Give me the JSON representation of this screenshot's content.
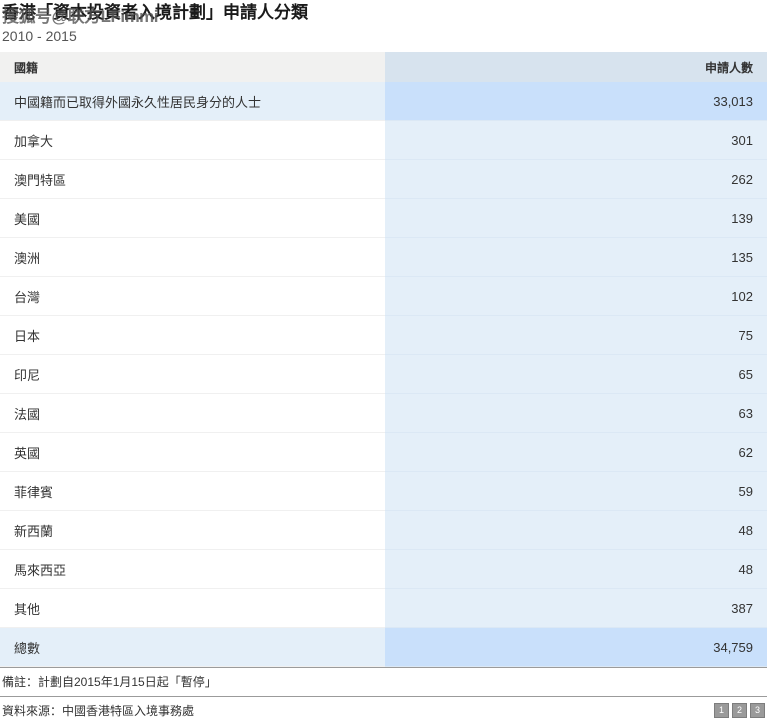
{
  "header": {
    "title": "香港「資本投資者入境計劃」申請人分類",
    "subtitle": "2010 - 2015",
    "watermark": "搜狐号@联方LFimmi"
  },
  "table": {
    "columns": {
      "name": "國籍",
      "value": "申請人數"
    },
    "rows": [
      {
        "name": "中國籍而已取得外國永久性居民身分的人士",
        "value": "33,013",
        "style": "highlight"
      },
      {
        "name": "加拿大",
        "value": "301",
        "style": "normal"
      },
      {
        "name": "澳門特區",
        "value": "262",
        "style": "normal"
      },
      {
        "name": "美國",
        "value": "139",
        "style": "normal"
      },
      {
        "name": "澳洲",
        "value": "135",
        "style": "normal"
      },
      {
        "name": "台灣",
        "value": "102",
        "style": "normal"
      },
      {
        "name": "日本",
        "value": "75",
        "style": "normal"
      },
      {
        "name": "印尼",
        "value": "65",
        "style": "normal"
      },
      {
        "name": "法國",
        "value": "63",
        "style": "normal"
      },
      {
        "name": "英國",
        "value": "62",
        "style": "normal"
      },
      {
        "name": "菲律賓",
        "value": "59",
        "style": "normal"
      },
      {
        "name": "新西蘭",
        "value": "48",
        "style": "normal"
      },
      {
        "name": "馬來西亞",
        "value": "48",
        "style": "normal"
      },
      {
        "name": "其他",
        "value": "387",
        "style": "normal"
      },
      {
        "name": "總數",
        "value": "34,759",
        "style": "total"
      }
    ]
  },
  "footnotes": [
    {
      "text": "備註：計劃自2015年1月15日起「暫停」"
    },
    {
      "text": "資料來源：中國香港特區入境事務處"
    }
  ],
  "badges": [
    "1",
    "2",
    "3"
  ],
  "colors": {
    "header_name_bg": "#f1f1f0",
    "header_value_bg": "#d7e3ee",
    "value_column_bg": "#e4eff9",
    "highlight_value_bg": "#c9e0fb"
  },
  "chart_data": {
    "type": "table",
    "title": "香港「資本投資者入境計劃」申請人分類",
    "subtitle": "2010 - 2015",
    "categories": [
      "中國籍而已取得外國永久性居民身分的人士",
      "加拿大",
      "澳門特區",
      "美國",
      "澳洲",
      "台灣",
      "日本",
      "印尼",
      "法國",
      "英國",
      "菲律賓",
      "新西蘭",
      "馬來西亞",
      "其他"
    ],
    "values": [
      33013,
      301,
      262,
      139,
      135,
      102,
      75,
      65,
      63,
      62,
      59,
      48,
      48,
      387
    ],
    "total": 34759,
    "xlabel": "國籍",
    "ylabel": "申請人數"
  }
}
